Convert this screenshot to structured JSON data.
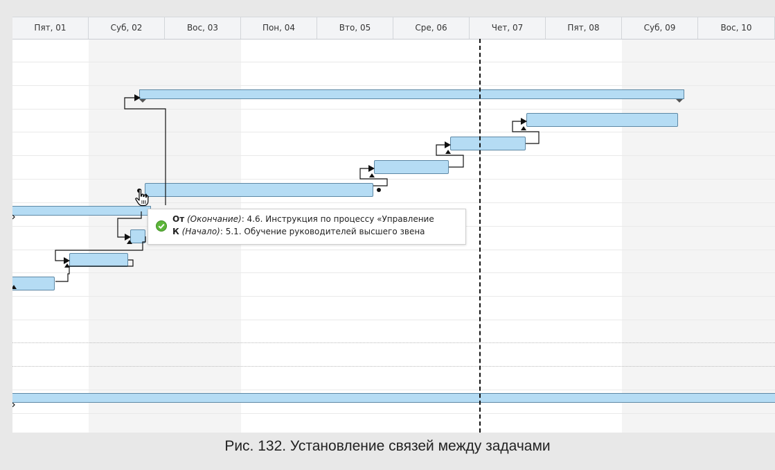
{
  "timeline": {
    "days": [
      "Пят, 01",
      "Суб, 02",
      "Вос, 03",
      "Пон, 04",
      "Вто, 05",
      "Сре, 06",
      "Чет, 07",
      "Пят, 08",
      "Суб, 09",
      "Вос, 10"
    ]
  },
  "tooltip": {
    "from_label": "От",
    "from_type": "(Окончание)",
    "from_text": ": 4.6. Инструкция по процессу «Управление",
    "to_label": "К",
    "to_type": "(Начало)",
    "to_text": ": 5.1. Обучение руководителей высшего звена",
    "status_icon": "check-circle-icon"
  },
  "cursor_icon": "hand-pointer-icon",
  "caption": "Рис. 132. Установление связей между задачами",
  "colors": {
    "bar_fill": "#b5dcf4",
    "bar_border": "#5d88a5",
    "today_line": "#111111",
    "success": "#5cb53a"
  }
}
